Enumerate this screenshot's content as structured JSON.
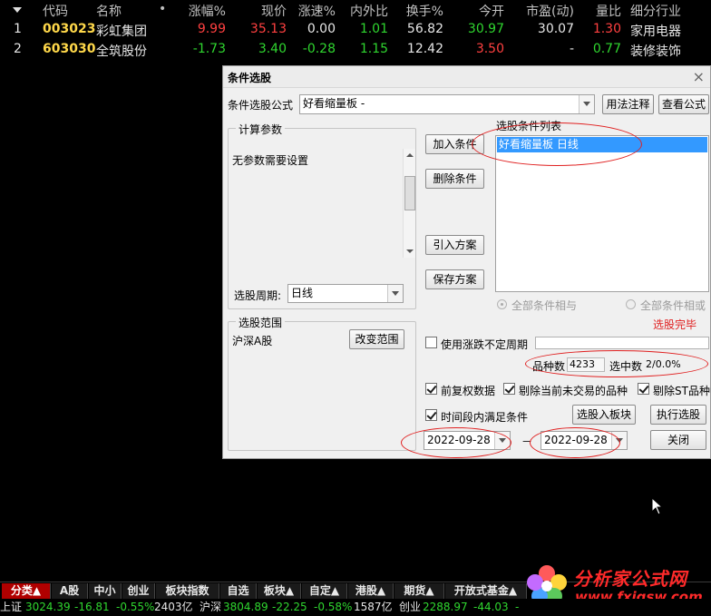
{
  "table": {
    "headers": {
      "code": "代码",
      "name": "名称",
      "dot": "•",
      "change_pct": "涨幅%",
      "price": "现价",
      "speed": "涨速%",
      "in_out_ratio": "内外比",
      "turnover": "换手%",
      "open": "今开",
      "pe": "市盈(动)",
      "volume_ratio": "量比",
      "industry": "细分行业"
    },
    "rows": [
      {
        "idx": "1",
        "code": "003023",
        "name": "彩虹集团",
        "change_pct": "9.99",
        "price": "35.13",
        "speed": "0.00",
        "in_out_ratio": "1.01",
        "turnover": "56.82",
        "open": "30.97",
        "pe": "30.07",
        "volume_ratio": "1.30",
        "industry": "家用电器"
      },
      {
        "idx": "2",
        "code": "603030",
        "name": "全筑股份",
        "change_pct": "-1.73",
        "price": "3.40",
        "speed": "-0.28",
        "in_out_ratio": "1.15",
        "turnover": "12.42",
        "open": "3.50",
        "pe": "-",
        "volume_ratio": "0.77",
        "industry": "装修装饰"
      }
    ]
  },
  "dialog": {
    "title": "条件选股",
    "formula_label": "条件选股公式",
    "formula_value": "好看缩量板    -",
    "usage_button": "用法注释",
    "view_formula_button": "查看公式",
    "params_group": "计算参数",
    "params_text": "无参数需要设置",
    "period_label": "选股周期:",
    "period_value": "日线",
    "add_condition": "加入条件",
    "delete_condition": "删除条件",
    "import_plan": "引入方案",
    "save_plan": "保存方案",
    "condition_list_label": "选股条件列表",
    "condition_list_items": [
      "好看缩量板   日线"
    ],
    "radio_and": "全部条件相与",
    "radio_or": "全部条件相或",
    "done_text": "选股完毕",
    "range_group": "选股范围",
    "range_value": "沪深A股",
    "change_range": "改变范围",
    "use_volatile_period": "使用涨跌不定周期",
    "progress_fraction": 0,
    "count_label": "品种数",
    "count_value": "4233",
    "selected_label": "选中数",
    "selected_value": "2/0.0%",
    "prev_adjust": "前复权数据",
    "exclude_untraded": "剔除当前未交易的品种",
    "exclude_st": "剔除ST品种",
    "time_range_satisfy": "时间段内满足条件",
    "to_block": "选股入板块",
    "execute": "执行选股",
    "date_from": "2022-09-28",
    "date_sep": "－",
    "date_to": "2022-09-28",
    "close": "关闭"
  },
  "tabs": [
    "分类▲",
    "A股",
    "中小",
    "创业",
    "板块指数",
    "自选",
    "板块▲",
    "自定▲",
    "港股▲",
    "期货▲",
    "开放式基金▲"
  ],
  "logo": {
    "cn": "分析家公式网",
    "url": "www.fxjgsw.com"
  },
  "status": {
    "sh_name": "上证",
    "sh_value": "3024.39",
    "sh_change": "-16.81",
    "sh_pct": "-0.55%",
    "sh_amount": "2403亿",
    "hs_name": "沪深",
    "hs_value": "3804.89",
    "hs_change": "-22.25",
    "hs_pct": "-0.58%",
    "hs_amount": "1587亿",
    "cy_name": "创业",
    "cy_value": "2288.97",
    "cy_change": "-44.03",
    "cy_tail": "-"
  },
  "colors": {
    "up": "#ff4040",
    "down": "#2fd62f",
    "code": "#ffd84a",
    "annotation": "#e02020",
    "tab_active": "#b00000"
  }
}
